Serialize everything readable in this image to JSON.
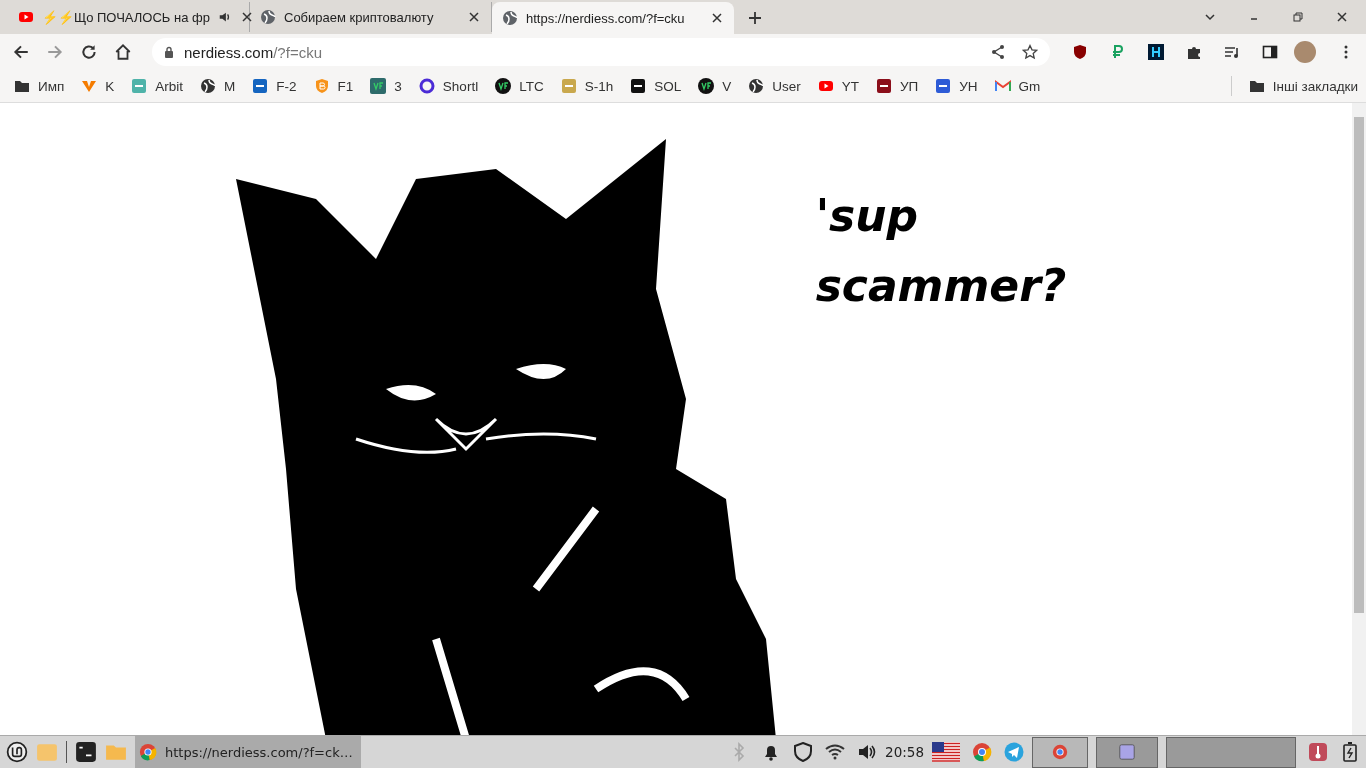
{
  "tabs": [
    {
      "title": "⚡⚡Що ПОЧАЛОСЬ на фр",
      "kind": "youtube",
      "audio": true,
      "selected": false
    },
    {
      "title": "Собираем криптовалюту",
      "kind": "globe",
      "audio": false,
      "selected": false
    },
    {
      "title": "https://nerdiess.com/?f=cku",
      "kind": "globe",
      "audio": false,
      "selected": true
    }
  ],
  "address": {
    "domain": "nerdiess.com",
    "path": "/?f=cku"
  },
  "bookmarks": [
    {
      "label": "Имп",
      "kind": "folder"
    },
    {
      "label": "K",
      "kind": "vee"
    },
    {
      "label": "Arbit",
      "kind": "swirl"
    },
    {
      "label": "M",
      "kind": "globe"
    },
    {
      "label": "F-2",
      "kind": "fish"
    },
    {
      "label": "F1",
      "kind": "bitcoin"
    },
    {
      "label": "3",
      "kind": "vf-square"
    },
    {
      "label": "Shortl",
      "kind": "ring"
    },
    {
      "label": "LTC",
      "kind": "vf-circle"
    },
    {
      "label": "S-1h",
      "kind": "aeg"
    },
    {
      "label": "SOL",
      "kind": "sol"
    },
    {
      "label": "V",
      "kind": "vf-circle"
    },
    {
      "label": "User",
      "kind": "globe"
    },
    {
      "label": "YT",
      "kind": "youtube"
    },
    {
      "label": "УП",
      "kind": "up"
    },
    {
      "label": "УН",
      "kind": "un"
    },
    {
      "label": "Gm",
      "kind": "gmail"
    }
  ],
  "other_bookmarks": "Інші закладки",
  "page": {
    "heading_line_1": "'sup",
    "heading_line_2": "scammer?"
  },
  "taskbar": {
    "window_title": "https://nerdiess.com/?f=ck…",
    "clock": "20:58"
  }
}
